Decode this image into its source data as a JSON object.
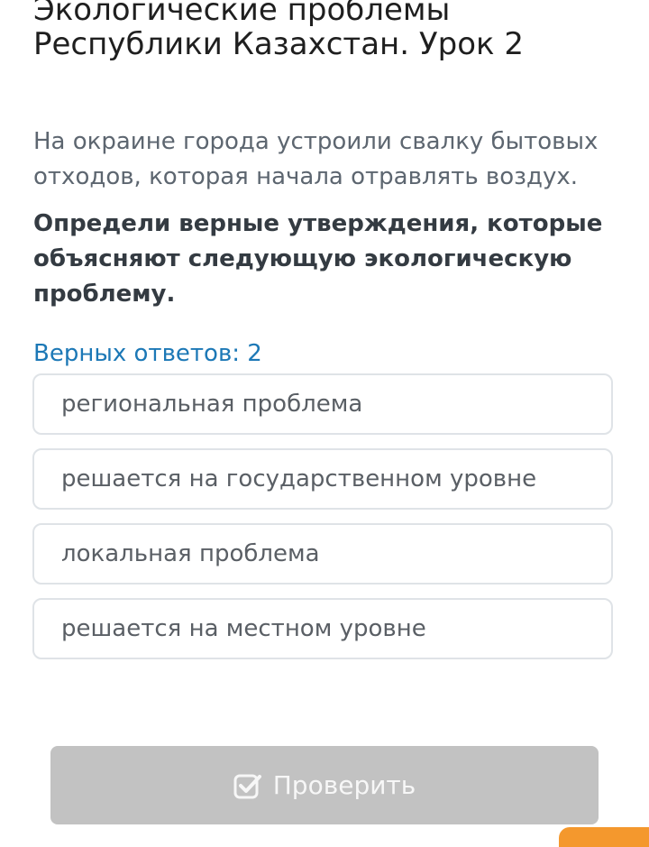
{
  "lesson": {
    "title_line1": "Экологические проблемы",
    "title_line2": "Республики Казахстан. Урок 2"
  },
  "question": {
    "prompt_line1": "На окраине города устроили свалку бытовых",
    "prompt_line2": "отходов, которая начала отравлять воздух.",
    "instruction_line1": "Определи верные утверждения, которые",
    "instruction_line2": "объясняют следующую экологическую",
    "instruction_line3": "проблему.",
    "answers_count": "Верных ответов: 2"
  },
  "options": [
    "региональная проблема",
    "решается на государственном уровне",
    "локальная проблема",
    "решается на местном уровне"
  ],
  "check_button": {
    "label": "Проверить",
    "icon": "checkbox-check-icon"
  },
  "colors": {
    "accent_link": "#1c78b6",
    "button_disabled": "#c2c2c2",
    "corner_accent": "#f4982d"
  }
}
